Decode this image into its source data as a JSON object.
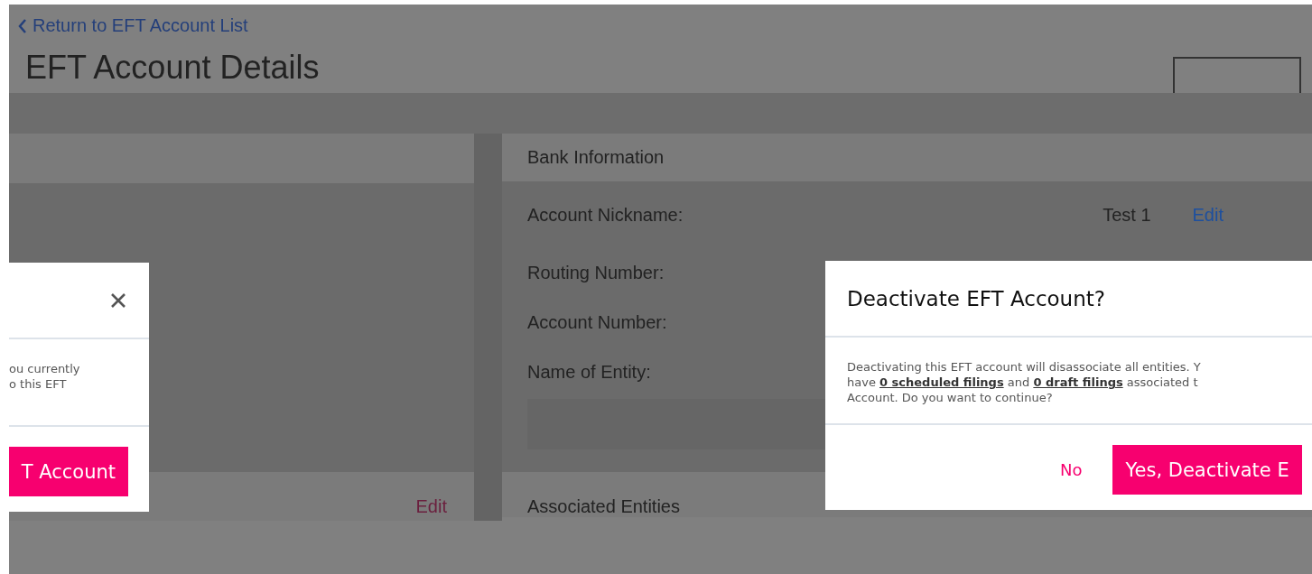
{
  "back_link": {
    "label": "Return to EFT Account List"
  },
  "page_title": "EFT Account Details",
  "bank_information": {
    "title": "Bank Information",
    "fields": [
      {
        "label": "Account Nickname:",
        "value": "Test 1",
        "action": "Edit"
      },
      {
        "label": "Routing Number:"
      },
      {
        "label": "Account Number:"
      },
      {
        "label": "Name of Entity:"
      }
    ]
  },
  "associated_entities": {
    "title": "Associated Entities"
  },
  "left_panel": {
    "action": "Edit"
  },
  "left_dialog": {
    "message_lines": [
      "ou currently",
      "o this EFT"
    ],
    "confirm_button": "T Account"
  },
  "right_dialog": {
    "title": "Deactivate EFT Account?",
    "message_lines": [
      "Deactivating this EFT account will disassociate all entities. Y",
      "have **0 scheduled filings** and **0 draft filings** associated t",
      "Account. Do you want to continue?"
    ],
    "cancel_button": "No",
    "confirm_button": "Yes, Deactivate E"
  }
}
